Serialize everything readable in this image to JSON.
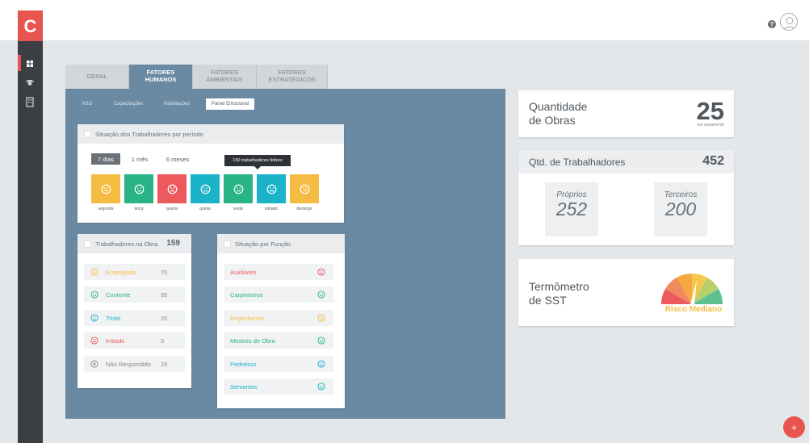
{
  "app": {
    "logo_letter": "C",
    "help_glyph": "?"
  },
  "tabs": [
    {
      "line1": "GERAL",
      "line2": ""
    },
    {
      "line1": "FATORES",
      "line2": "HUMANOS"
    },
    {
      "line1": "FATORES",
      "line2": "AMBIENTAIS"
    },
    {
      "line1": "FATORES",
      "line2": "ESTRATÉGICOS"
    }
  ],
  "subtabs": [
    "ASO",
    "Capacitações",
    "Habilitações",
    "Painel Emocional"
  ],
  "situacao_periodo": {
    "title": "Situação dos Trabalhadores por período",
    "periods": [
      "7 dias",
      "1 mês",
      "6 meses"
    ],
    "tooltip": "150 trabalhadores felizes",
    "days": [
      {
        "label": "segunda",
        "mood": "empolgado",
        "color": "#f5bc43"
      },
      {
        "label": "terça",
        "mood": "contente",
        "color": "#28b487"
      },
      {
        "label": "quarta",
        "mood": "irritado",
        "color": "#ec5a5d"
      },
      {
        "label": "quinta",
        "mood": "triste",
        "color": "#1ab3c8"
      },
      {
        "label": "sexta",
        "mood": "contente",
        "color": "#28b487"
      },
      {
        "label": "sábado",
        "mood": "triste",
        "color": "#1ab3c8"
      },
      {
        "label": "domingo",
        "mood": "empolgado",
        "color": "#f5bc43"
      }
    ]
  },
  "trabalhadores_obra": {
    "title": "Trabalhadores na Obra",
    "total": "159",
    "rows": [
      {
        "label": "Empolgado",
        "value": "70",
        "color": "#f5bc43",
        "icon": "happy-icon"
      },
      {
        "label": "Contente",
        "value": "35",
        "color": "#28b487",
        "icon": "smile-icon"
      },
      {
        "label": "Triste",
        "value": "20",
        "color": "#1ab3c8",
        "icon": "sad-icon"
      },
      {
        "label": "Irritado",
        "value": "5",
        "color": "#ec5a5d",
        "icon": "angry-icon"
      },
      {
        "label": "Não Respondido",
        "value": "29",
        "color": "#85898d",
        "icon": "x-circle-icon"
      }
    ]
  },
  "situacao_funcao": {
    "title": "Situação por Função",
    "rows": [
      {
        "label": "Auxiliares",
        "color": "#ec5a5d",
        "icon": "angry-icon"
      },
      {
        "label": "Carpinteiros",
        "color": "#28b487",
        "icon": "smile-icon"
      },
      {
        "label": "Engenheiros",
        "color": "#f5bc43",
        "icon": "happy-icon"
      },
      {
        "label": "Mestres de Obra",
        "color": "#28b487",
        "icon": "smile-icon"
      },
      {
        "label": "Pedreiros",
        "color": "#1ab3c8",
        "icon": "sad-icon"
      },
      {
        "label": "Serventes",
        "color": "#1ab3c8",
        "icon": "sad-icon"
      }
    ]
  },
  "quantidade_obras": {
    "line1": "Quantidade",
    "line2": "de Obras",
    "value": "25",
    "sub": "em andamento"
  },
  "qtd_trabalhadores": {
    "title": "Qtd. de Trabalhadores",
    "total": "452",
    "proprios_label": "Próprios",
    "proprios": "252",
    "terceiros_label": "Terceiros",
    "terceiros": "200"
  },
  "termometro": {
    "line1": "Termômetro",
    "line2": "de SST",
    "status": "Risco Mediano",
    "status_color": "#f5bc43"
  },
  "fab": {
    "label": "+"
  }
}
